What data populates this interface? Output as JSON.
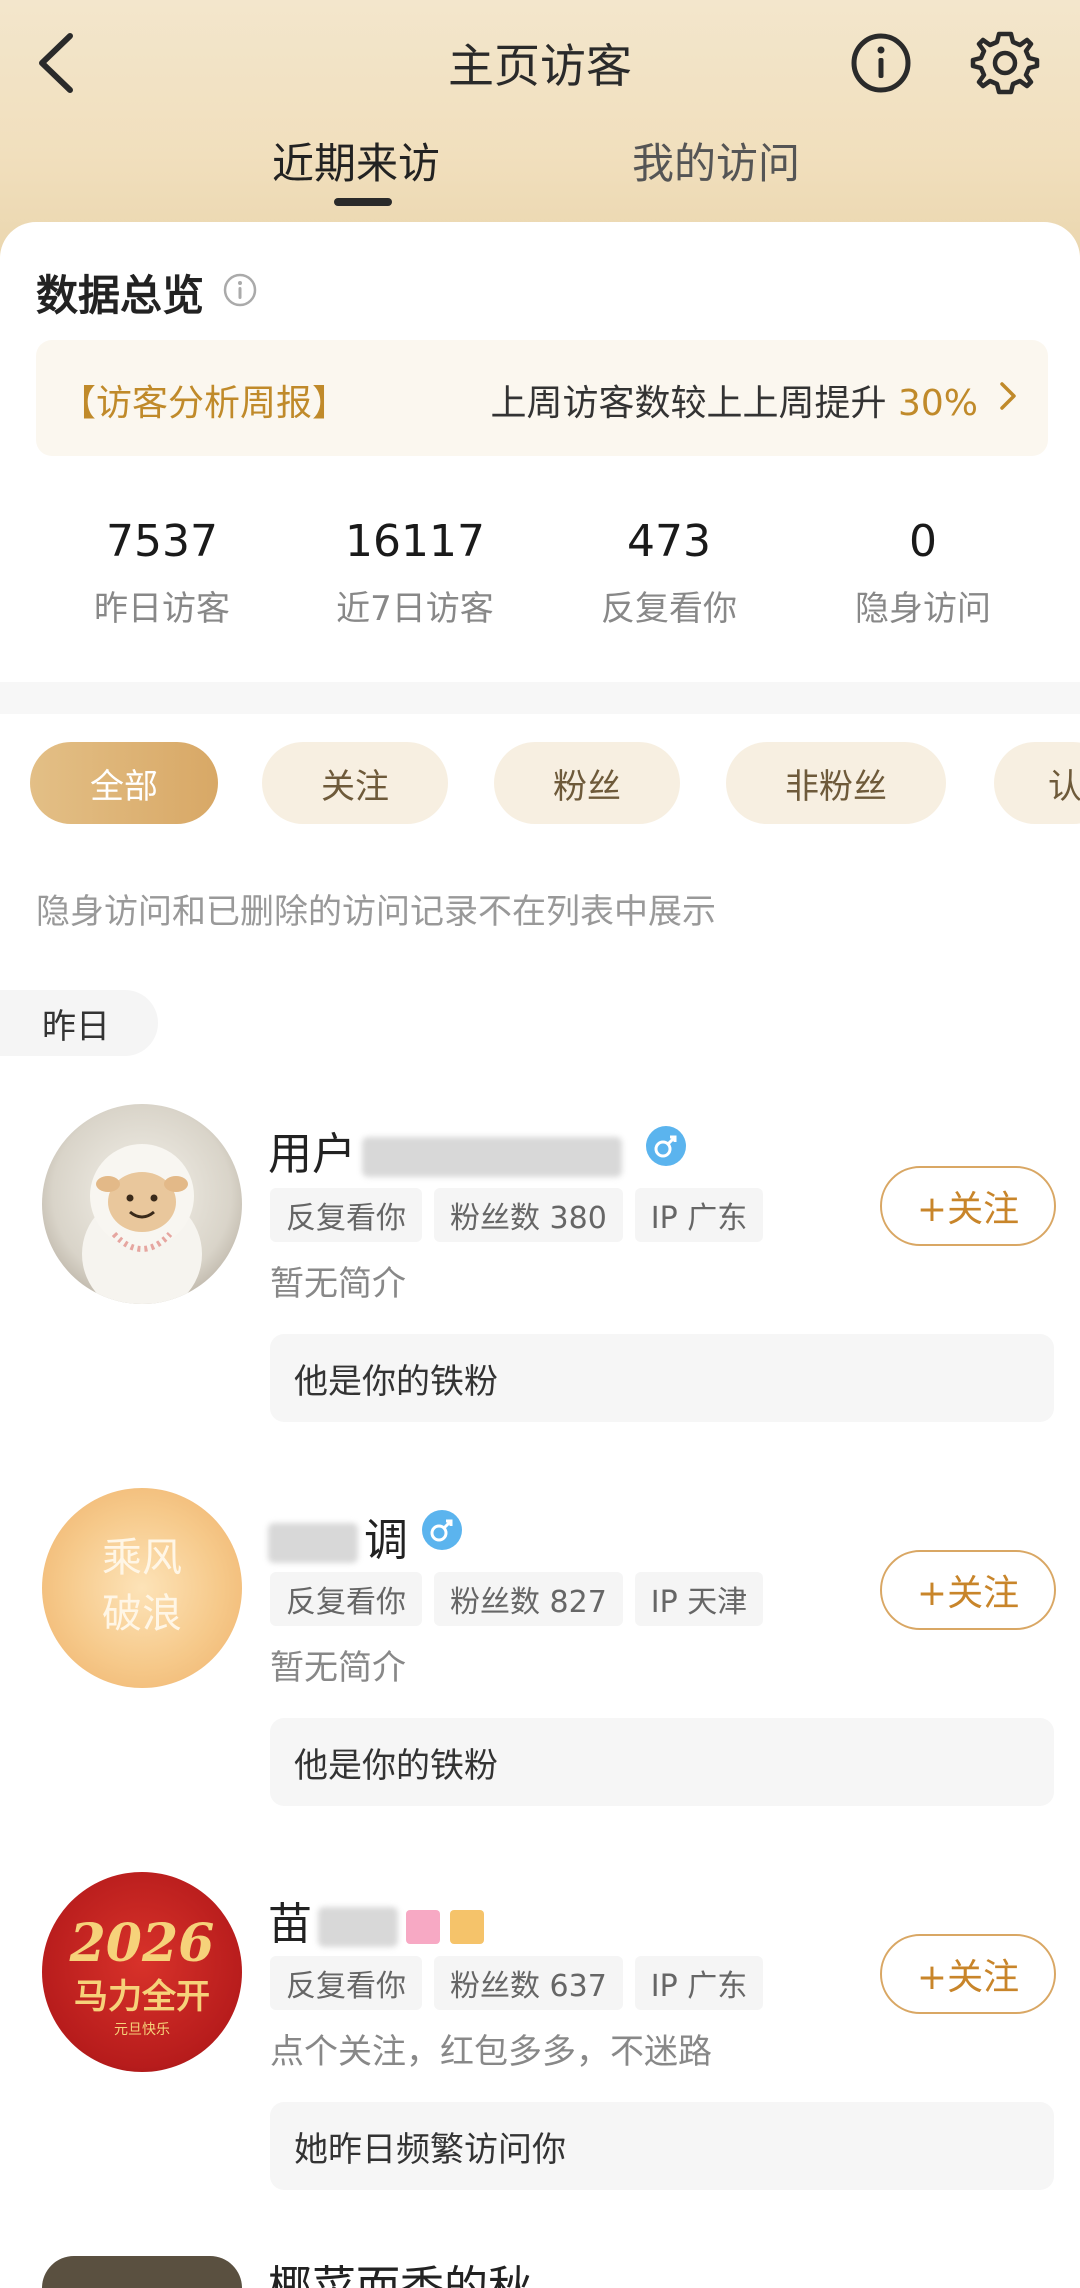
{
  "header": {
    "title": "主页访客",
    "tabs": [
      {
        "label": "近期来访",
        "active": true
      },
      {
        "label": "我的访问",
        "active": false
      }
    ]
  },
  "overview": {
    "title": "数据总览",
    "report": {
      "label": "【访客分析周报】",
      "text": "上周访客数较上上周提升",
      "percent": "30%"
    },
    "stats": [
      {
        "value": "7537",
        "label": "昨日访客"
      },
      {
        "value": "16117",
        "label": "近7日访客"
      },
      {
        "value": "473",
        "label": "反复看你"
      },
      {
        "value": "0",
        "label": "隐身访问"
      }
    ]
  },
  "filters": [
    {
      "label": "全部",
      "active": true
    },
    {
      "label": "关注",
      "active": false
    },
    {
      "label": "粉丝",
      "active": false
    },
    {
      "label": "非粉丝",
      "active": false
    },
    {
      "label": "认",
      "active": false
    }
  ],
  "note": "隐身访问和已删除的访问记录不在列表中展示",
  "day_label": "昨日",
  "visitors": [
    {
      "name_visible": "用户",
      "tags": [
        "反复看你",
        "粉丝数 380",
        "IP 广东"
      ],
      "bio": "暂无简介",
      "reason": "他是你的铁粉",
      "follow_label": "+关注",
      "gender": "male"
    },
    {
      "name_visible": "调",
      "tags": [
        "反复看你",
        "粉丝数 827",
        "IP 天津"
      ],
      "bio": "暂无简介",
      "reason": "他是你的铁粉",
      "follow_label": "+关注",
      "gender": "male",
      "avatar_text": [
        "乘风",
        "破浪"
      ]
    },
    {
      "name_visible": "苗",
      "tags": [
        "反复看你",
        "粉丝数 637",
        "IP 广东"
      ],
      "bio": "点个关注，红包多多，不迷路",
      "reason": "她昨日频繁访问你",
      "follow_label": "+关注",
      "avatar_text": [
        "2026",
        "马力全开",
        "元旦快乐"
      ]
    },
    {
      "name_visible": "椰菜而香的秋"
    }
  ],
  "colors": {
    "accent": "#c8852a",
    "header_bg": "#f1dfbd",
    "gender_male": "#5bb4ee"
  }
}
